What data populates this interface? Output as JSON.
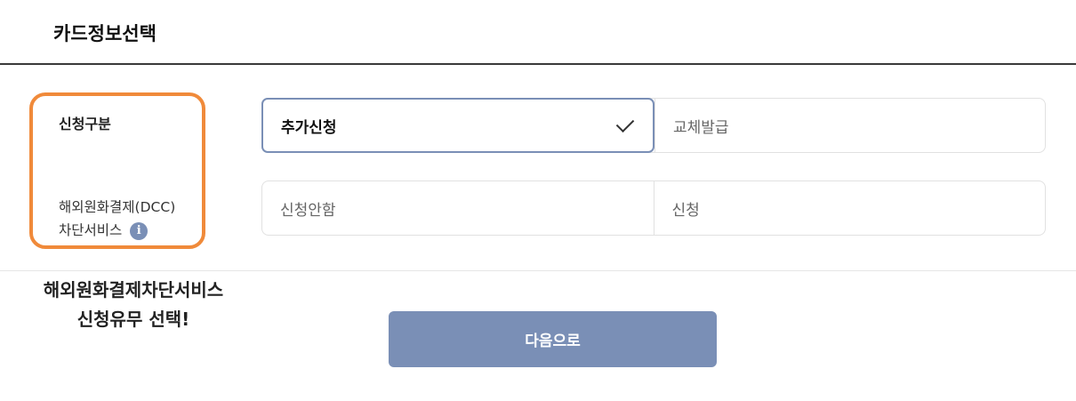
{
  "header": {
    "title": "카드정보선택"
  },
  "form": {
    "rows": [
      {
        "label": "신청구분",
        "options": [
          {
            "label": "추가신청",
            "selected": true
          },
          {
            "label": "교체발급",
            "selected": false
          }
        ]
      },
      {
        "label_line1": "해외원화결제(DCC)",
        "label_line2": "차단서비스",
        "info_icon": "info-icon",
        "options": [
          {
            "label": "신청안함",
            "selected": false
          },
          {
            "label": "신청",
            "selected": false
          }
        ]
      }
    ]
  },
  "annotation": {
    "line1": "해외원화결제차단서비스",
    "line2": "신청유무 선택!",
    "highlight_color": "#f08a3a"
  },
  "actions": {
    "next_label": "다음으로"
  },
  "colors": {
    "accent": "#7a8fb6"
  }
}
